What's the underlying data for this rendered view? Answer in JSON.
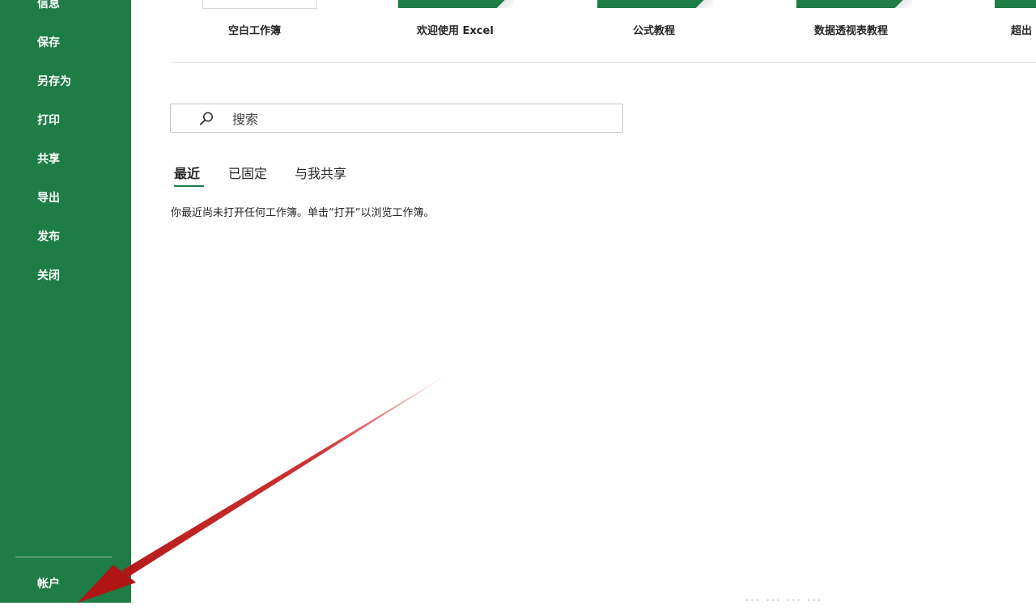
{
  "sidebar": {
    "items": [
      {
        "label": "信息"
      },
      {
        "label": "保存"
      },
      {
        "label": "另存为"
      },
      {
        "label": "打印"
      },
      {
        "label": "共享"
      },
      {
        "label": "导出"
      },
      {
        "label": "发布"
      },
      {
        "label": "关闭"
      }
    ],
    "account_label": "帐户"
  },
  "templates": [
    {
      "label": "空白工作簿",
      "thumb": "blank"
    },
    {
      "label": "欢迎使用 Excel",
      "thumb": "green"
    },
    {
      "label": "公式教程",
      "thumb": "green"
    },
    {
      "label": "数据透视表教程",
      "thumb": "green"
    },
    {
      "label": "超出",
      "thumb": "green"
    }
  ],
  "search": {
    "placeholder": "搜索",
    "icon": "search-icon"
  },
  "tabs": [
    {
      "label": "最近",
      "active": true
    },
    {
      "label": "已固定",
      "active": false
    },
    {
      "label": "与我共享",
      "active": false
    }
  ],
  "recent": {
    "empty_message": "你最近尚未打开任何工作簿。单击“打开”以浏览工作簿。"
  },
  "colors": {
    "accent": "#1e7c45",
    "arrow": "#c81e1e"
  }
}
